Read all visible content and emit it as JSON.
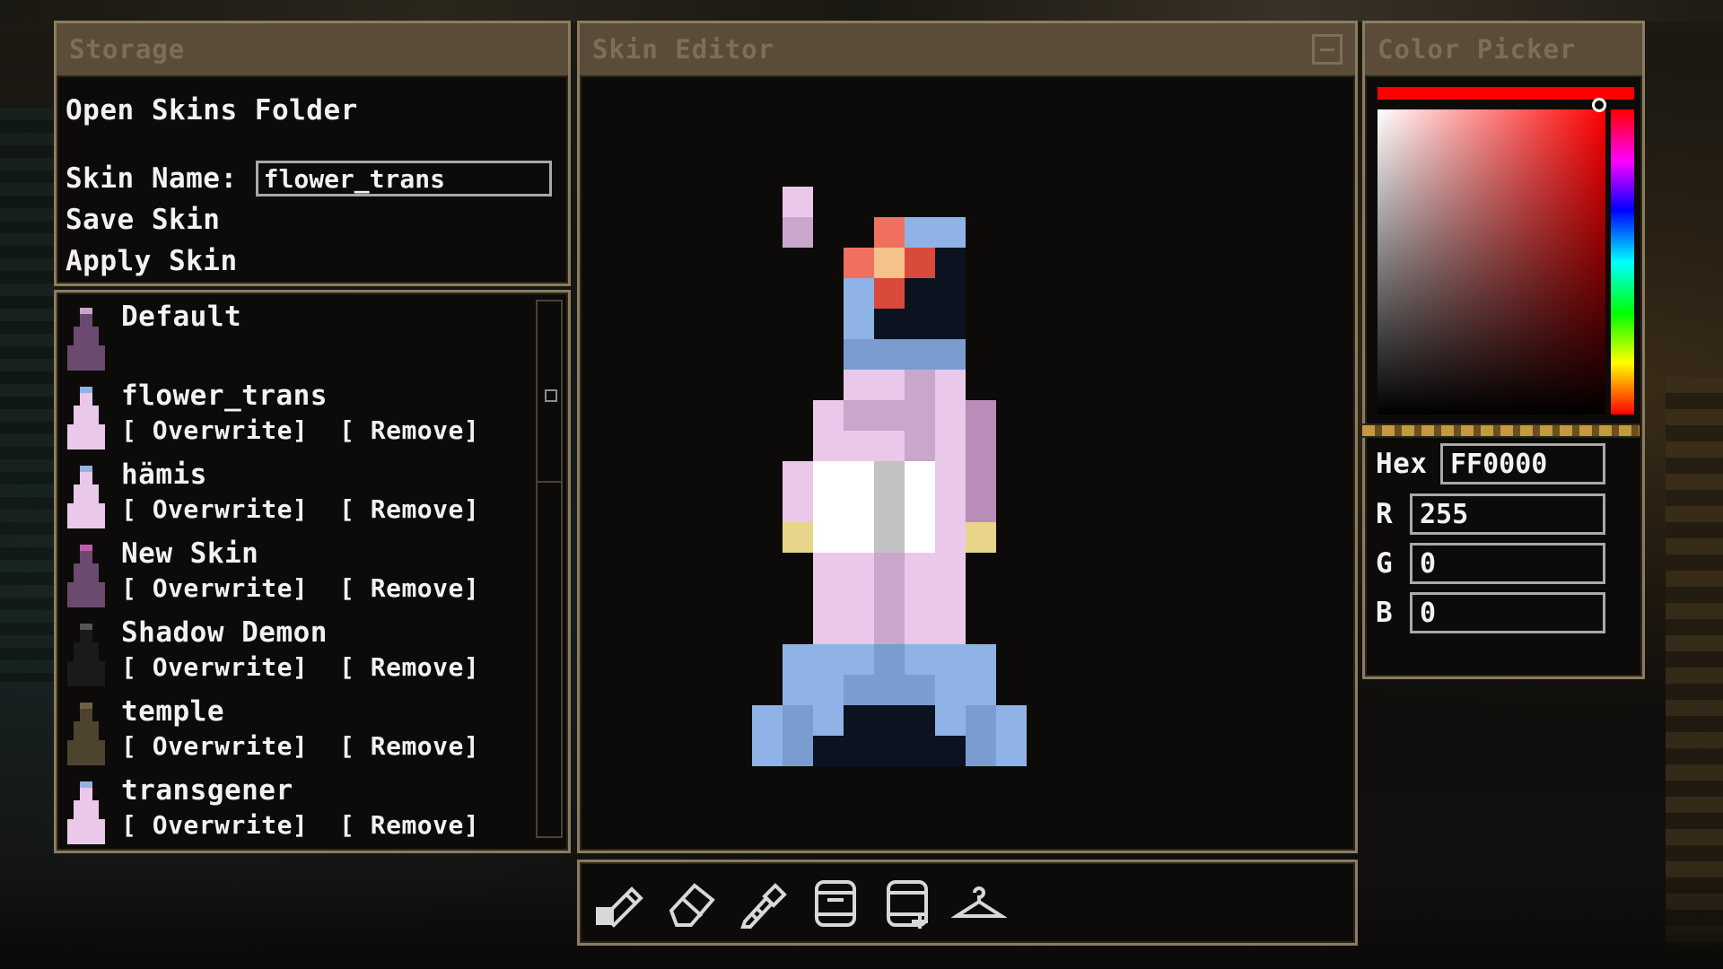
{
  "storage": {
    "title": "Storage",
    "open_folder_label": "Open Skins Folder",
    "skin_name_label": "Skin Name:",
    "skin_name_value": "flower_trans",
    "save_label": "Save Skin",
    "apply_label": "Apply Skin"
  },
  "skins": {
    "overwrite_label": "[ Overwrite]",
    "remove_label": "[ Remove]",
    "items": [
      {
        "name": "Default",
        "thumb_color": "#6b4a6f",
        "accent": "#c9a6c9"
      },
      {
        "name": "flower_trans",
        "thumb_color": "#e9c8ea",
        "accent": "#8fb3e6"
      },
      {
        "name": "hämis",
        "thumb_color": "#e9c8ea",
        "accent": "#8fb3e6"
      },
      {
        "name": "New Skin",
        "thumb_color": "#6b4a6f",
        "accent": "#c45ab0"
      },
      {
        "name": "Shadow Demon",
        "thumb_color": "#1a1a1a",
        "accent": "#555555"
      },
      {
        "name": "temple",
        "thumb_color": "#4d4430",
        "accent": "#6e6146"
      },
      {
        "name": "transgener",
        "thumb_color": "#e9c8ea",
        "accent": "#8fb3e6"
      }
    ]
  },
  "editor": {
    "title": "Skin Editor"
  },
  "tools": [
    {
      "name": "pencil",
      "icon": "pencil-icon"
    },
    {
      "name": "eraser",
      "icon": "eraser-icon"
    },
    {
      "name": "eyedropper",
      "icon": "eyedropper-icon"
    },
    {
      "name": "fill-down",
      "icon": "fill-down-icon"
    },
    {
      "name": "fill-up",
      "icon": "fill-up-icon"
    },
    {
      "name": "hanger",
      "icon": "hanger-icon"
    }
  ],
  "color_picker": {
    "title": "Color Picker",
    "hex_label": "Hex",
    "hex_value": "FF0000",
    "r_label": "R",
    "r_value": "255",
    "g_label": "G",
    "g_value": "0",
    "b_label": "B",
    "b_value": "0",
    "selected_color": "#ff0000"
  },
  "palette": {
    "lp": "#e9c8ea",
    "mp": "#c9a6cc",
    "dp": "#b98db8",
    "wh": "#ffffff",
    "gy": "#c2c2c2",
    "yl": "#e8d58a",
    "lb": "#8fb3e6",
    "mb": "#7a9ccf",
    "nv": "#0d1220",
    "rd": "#d94a3c",
    "or": "#f07060",
    "pe": "#f5c28a"
  }
}
